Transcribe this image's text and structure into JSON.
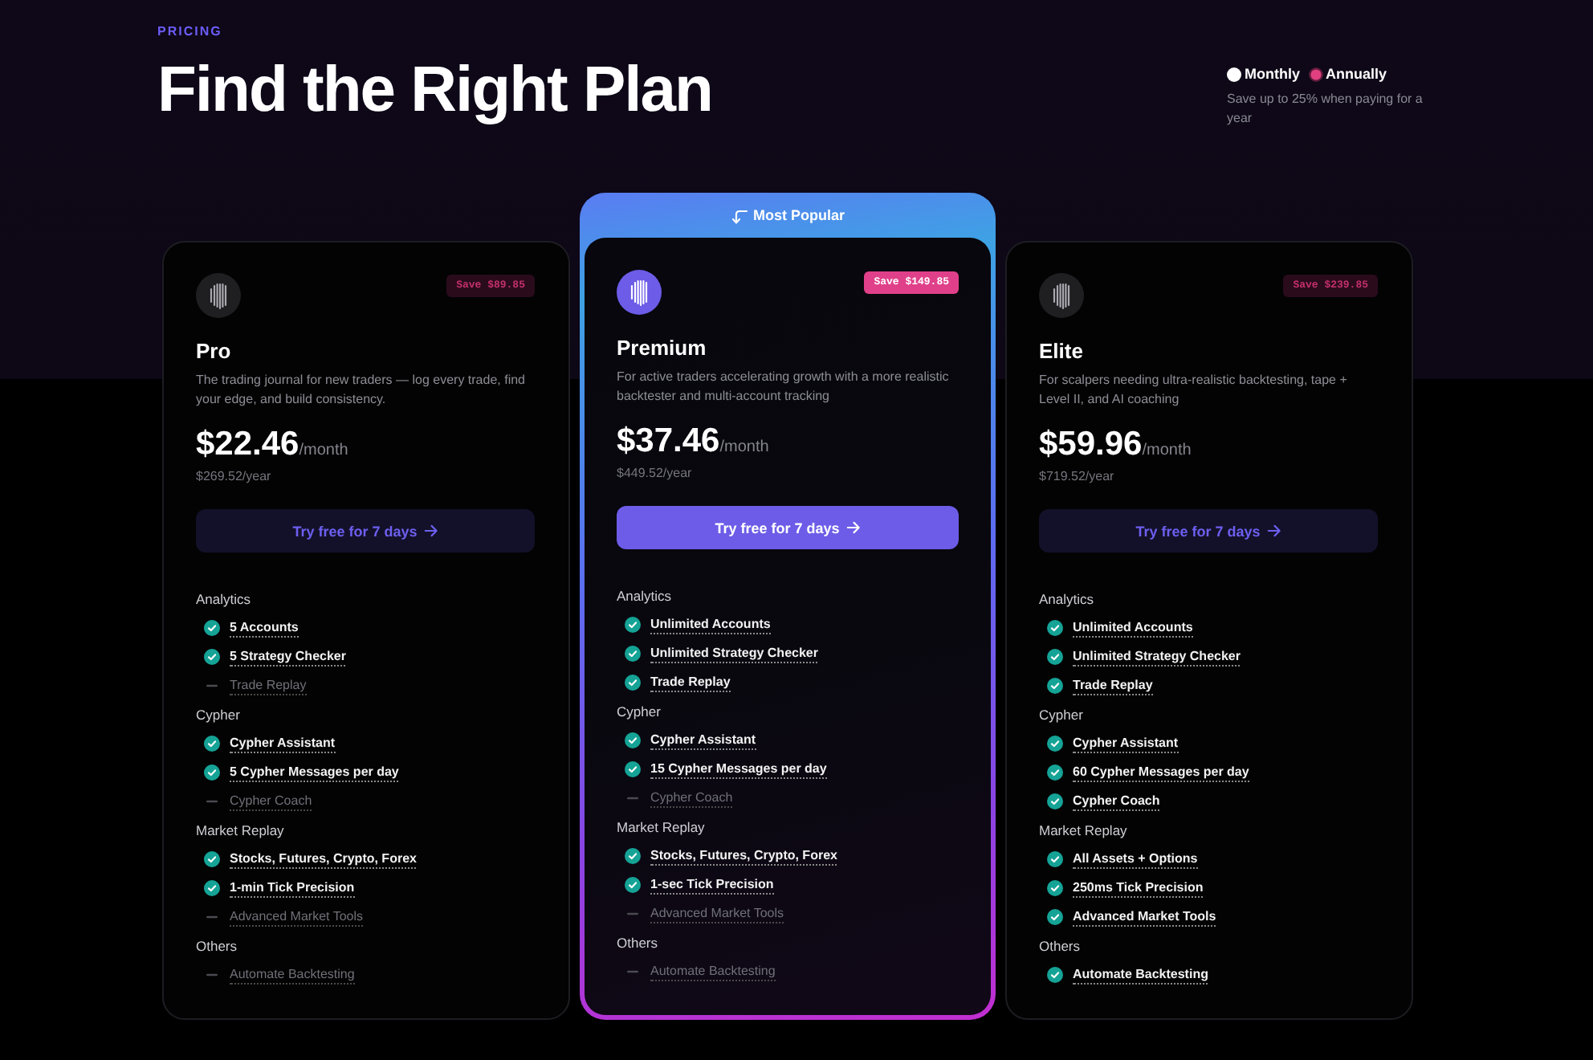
{
  "header": {
    "eyebrow": "PRICING",
    "title": "Find the Right Plan"
  },
  "billing": {
    "options": [
      {
        "label": "Monthly",
        "selected": false
      },
      {
        "label": "Annually",
        "selected": true
      }
    ],
    "note": "Save up to 25% when paying for a year"
  },
  "plans": [
    {
      "name": "Pro",
      "highlighted": false,
      "badge": "Save $89.85",
      "description": "The trading journal for new traders — log every trade, find your edge, and build consistency.",
      "price": "$22.46",
      "period": "/month",
      "yearly": "$269.52/year",
      "cta": "Try free for 7 days",
      "sections": [
        {
          "title": "Analytics",
          "features": [
            {
              "label": "5 Accounts",
              "included": true
            },
            {
              "label": "5 Strategy Checker",
              "included": true
            },
            {
              "label": "Trade Replay",
              "included": false
            }
          ]
        },
        {
          "title": "Cypher",
          "features": [
            {
              "label": "Cypher Assistant",
              "included": true
            },
            {
              "label": "5 Cypher Messages per day",
              "included": true
            },
            {
              "label": "Cypher Coach",
              "included": false
            }
          ]
        },
        {
          "title": "Market Replay",
          "features": [
            {
              "label": "Stocks, Futures, Crypto, Forex",
              "included": true
            },
            {
              "label": "1-min Tick Precision",
              "included": true
            },
            {
              "label": "Advanced Market Tools",
              "included": false
            }
          ]
        },
        {
          "title": "Others",
          "features": [
            {
              "label": "Automate Backtesting",
              "included": false
            }
          ]
        }
      ]
    },
    {
      "name": "Premium",
      "highlighted": true,
      "banner": "Most Popular",
      "badge": "Save $149.85",
      "description": "For active traders accelerating growth with a more realistic backtester and multi-account tracking",
      "price": "$37.46",
      "period": "/month",
      "yearly": "$449.52/year",
      "cta": "Try free for 7 days",
      "sections": [
        {
          "title": "Analytics",
          "features": [
            {
              "label": "Unlimited Accounts",
              "included": true
            },
            {
              "label": "Unlimited Strategy Checker",
              "included": true
            },
            {
              "label": "Trade Replay",
              "included": true
            }
          ]
        },
        {
          "title": "Cypher",
          "features": [
            {
              "label": "Cypher Assistant",
              "included": true
            },
            {
              "label": "15 Cypher Messages per day",
              "included": true
            },
            {
              "label": "Cypher Coach",
              "included": false
            }
          ]
        },
        {
          "title": "Market Replay",
          "features": [
            {
              "label": "Stocks, Futures, Crypto, Forex",
              "included": true
            },
            {
              "label": "1-sec Tick Precision",
              "included": true
            },
            {
              "label": "Advanced Market Tools",
              "included": false
            }
          ]
        },
        {
          "title": "Others",
          "features": [
            {
              "label": "Automate Backtesting",
              "included": false
            }
          ]
        }
      ]
    },
    {
      "name": "Elite",
      "highlighted": false,
      "badge": "Save $239.85",
      "description": "For scalpers needing ultra-realistic backtesting, tape + Level II, and AI coaching",
      "price": "$59.96",
      "period": "/month",
      "yearly": "$719.52/year",
      "cta": "Try free for 7 days",
      "sections": [
        {
          "title": "Analytics",
          "features": [
            {
              "label": "Unlimited Accounts",
              "included": true
            },
            {
              "label": "Unlimited Strategy Checker",
              "included": true
            },
            {
              "label": "Trade Replay",
              "included": true
            }
          ]
        },
        {
          "title": "Cypher",
          "features": [
            {
              "label": "Cypher Assistant",
              "included": true
            },
            {
              "label": "60 Cypher Messages per day",
              "included": true
            },
            {
              "label": "Cypher Coach",
              "included": true
            }
          ]
        },
        {
          "title": "Market Replay",
          "features": [
            {
              "label": "All Assets + Options",
              "included": true
            },
            {
              "label": "250ms Tick Precision",
              "included": true
            },
            {
              "label": "Advanced Market Tools",
              "included": true
            }
          ]
        },
        {
          "title": "Others",
          "features": [
            {
              "label": "Automate Backtesting",
              "included": true
            }
          ]
        }
      ]
    }
  ]
}
